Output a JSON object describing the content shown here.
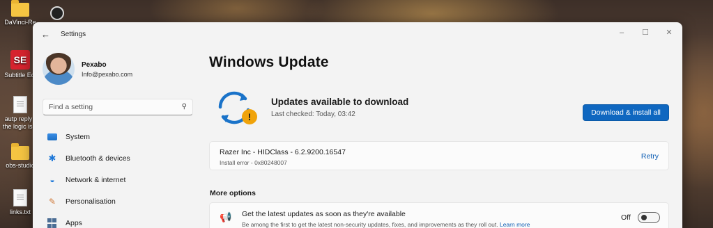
{
  "desktop": {
    "icons": [
      {
        "label": "DaVinci-Re",
        "icon": "folder-icon"
      },
      {
        "label": "Subtitle Edi",
        "icon": "subtitle-edit-icon",
        "glyph": "SE"
      },
      {
        "label": "autp reply t the logic is a",
        "icon": "text-file-icon"
      },
      {
        "label": "obs-studio",
        "icon": "folder-icon"
      },
      {
        "label": "links.txt",
        "icon": "text-file-icon"
      }
    ]
  },
  "window": {
    "app_title": "Settings",
    "back_glyph": "←",
    "controls": {
      "minimize": "–",
      "maximize": "☐",
      "close": "✕"
    }
  },
  "sidebar": {
    "profile": {
      "name": "Pexabo",
      "email": "Info@pexabo.com"
    },
    "search": {
      "placeholder": "Find a setting",
      "icon_glyph": "⚲"
    },
    "items": [
      {
        "label": "System",
        "icon": "system-icon"
      },
      {
        "label": "Bluetooth & devices",
        "icon": "bluetooth-icon",
        "glyph": "✱"
      },
      {
        "label": "Network & internet",
        "icon": "wifi-icon",
        "glyph": "◒"
      },
      {
        "label": "Personalisation",
        "icon": "brush-icon",
        "glyph": "✎"
      },
      {
        "label": "Apps",
        "icon": "apps-icon"
      }
    ]
  },
  "main": {
    "title": "Windows Update",
    "status": {
      "title": "Updates available to download",
      "last_checked": "Last checked: Today, 03:42",
      "warning_glyph": "!"
    },
    "primary_button": "Download & install all",
    "error_card": {
      "name": "Razer Inc - HIDClass - 6.2.9200.16547",
      "detail": "Install error - 0x80248007",
      "action": "Retry"
    },
    "more_options": {
      "heading": "More options",
      "items": [
        {
          "title": "Get the latest updates as soon as they're available",
          "description": "Be among the first to get the latest non-security updates, fixes, and improvements as they roll out.",
          "link": "Learn more",
          "toggle_label": "Off",
          "toggle_on": false,
          "icon_glyph": "📢"
        }
      ]
    }
  },
  "colors": {
    "accent": "#0f67c0",
    "warning": "#f0a30a",
    "window_bg": "#f3f3f3"
  }
}
